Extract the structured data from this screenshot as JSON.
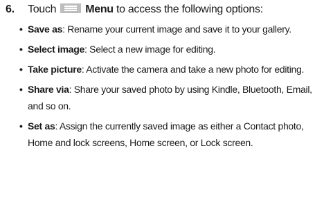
{
  "step": {
    "number": "6.",
    "prefix": "Touch",
    "icon": "menu-icon",
    "icon_color": "#bdbdbd",
    "label": "Menu",
    "suffix": "to access the following options:"
  },
  "options": [
    {
      "term": "Save as",
      "description": ": Rename your current image and save it to your gallery."
    },
    {
      "term": "Select image",
      "description": ": Select a new image for editing."
    },
    {
      "term": "Take picture",
      "description": ": Activate the camera and take a new photo for editing."
    },
    {
      "term": "Share via",
      "description": ": Share your saved photo by using Kindle, Bluetooth, Email, and so on."
    },
    {
      "term": "Set as",
      "description": ": Assign the currently saved image as either a Contact photo, Home and lock screens, Home screen, or Lock screen."
    }
  ]
}
